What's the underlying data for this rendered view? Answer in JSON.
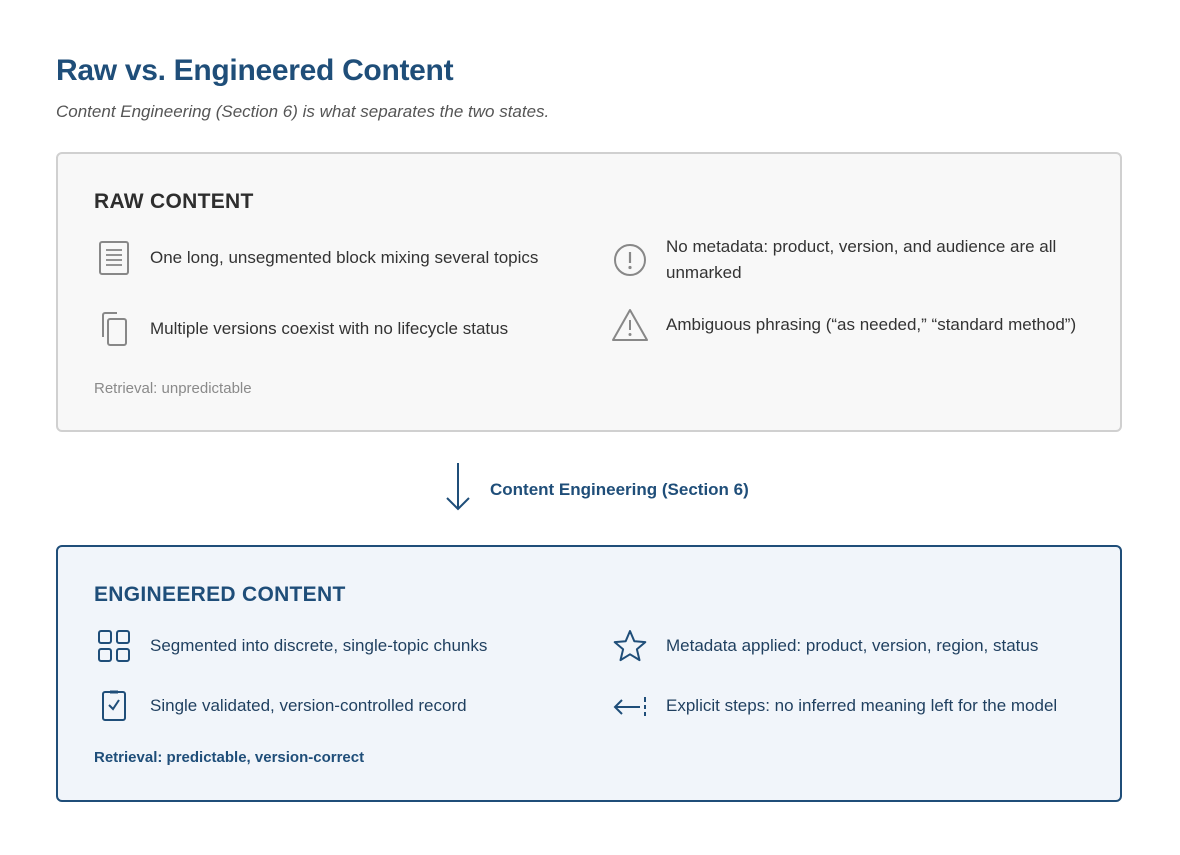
{
  "header": {
    "title": "Raw vs. Engineered Content",
    "subtitle": "Content Engineering (Section 6) is what separates the two states."
  },
  "raw": {
    "title": "RAW CONTENT",
    "items": [
      {
        "icon": "document-lines-icon",
        "text": "One long, unsegmented block mixing several topics"
      },
      {
        "icon": "exclamation-circle-icon",
        "text": "No metadata: product, version, and audience are all unmarked"
      },
      {
        "icon": "copies-icon",
        "text": "Multiple versions coexist with no lifecycle status"
      },
      {
        "icon": "warning-triangle-icon",
        "text": "Ambiguous phrasing (“as needed,” “standard method”)"
      }
    ],
    "footnote": "Retrieval: unpredictable"
  },
  "transition": {
    "icon": "arrow-down-icon",
    "label": "Content Engineering (Section 6)"
  },
  "engineered": {
    "title": "ENGINEERED CONTENT",
    "items": [
      {
        "icon": "grid-icon",
        "text": "Segmented into discrete, single-topic chunks"
      },
      {
        "icon": "star-icon",
        "text": "Metadata applied: product, version, region, status"
      },
      {
        "icon": "checked-doc-icon",
        "text": "Single validated, version-controlled record"
      },
      {
        "icon": "return-arrow-icon",
        "text": "Explicit steps: no inferred meaning left for the model"
      }
    ],
    "footnote": "Retrieval: predictable, version-correct"
  },
  "colors": {
    "accent": "#1f4e79",
    "raw_icon": "#888888",
    "raw_panel_bg": "#f8f8f8",
    "eng_panel_bg": "#f1f5fa"
  }
}
